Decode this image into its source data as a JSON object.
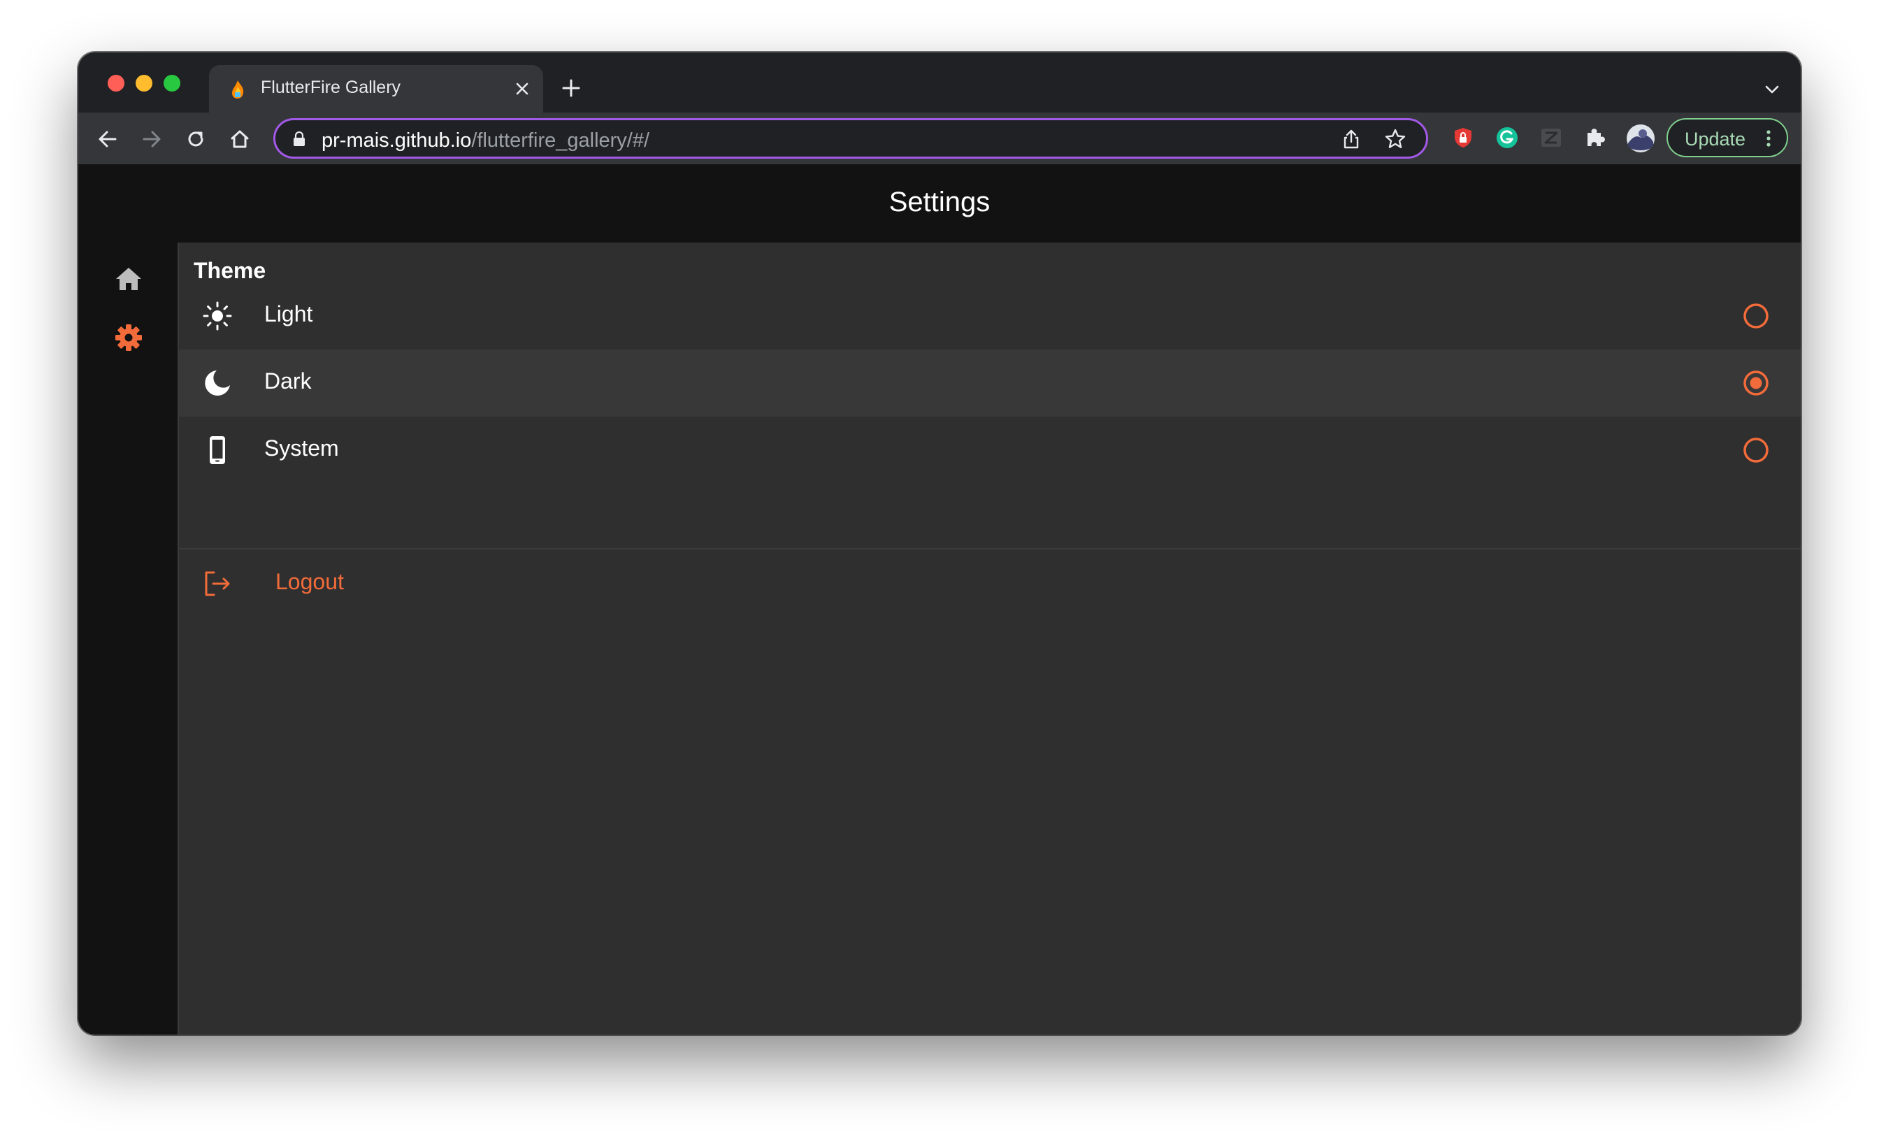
{
  "browser": {
    "tab_title": "FlutterFire Gallery",
    "url_host": "pr-mais.github.io",
    "url_path": "/flutterfire_gallery/#/",
    "update_label": "Update"
  },
  "app": {
    "title": "Settings",
    "rail": {
      "items": [
        {
          "name": "home",
          "icon": "home-icon",
          "selected": false
        },
        {
          "name": "settings",
          "icon": "gear-icon",
          "selected": true
        }
      ]
    },
    "theme": {
      "section_title": "Theme",
      "options": [
        {
          "label": "Light",
          "icon": "sun-icon",
          "selected": false
        },
        {
          "label": "Dark",
          "icon": "moon-icon",
          "selected": true
        },
        {
          "label": "System",
          "icon": "phone-icon",
          "selected": false
        }
      ]
    },
    "logout_label": "Logout"
  },
  "colors": {
    "accent": "#f26b3a",
    "app_background": "#2f2f2f",
    "app_bar": "#121212",
    "omnibox_border": "#a259e6"
  }
}
